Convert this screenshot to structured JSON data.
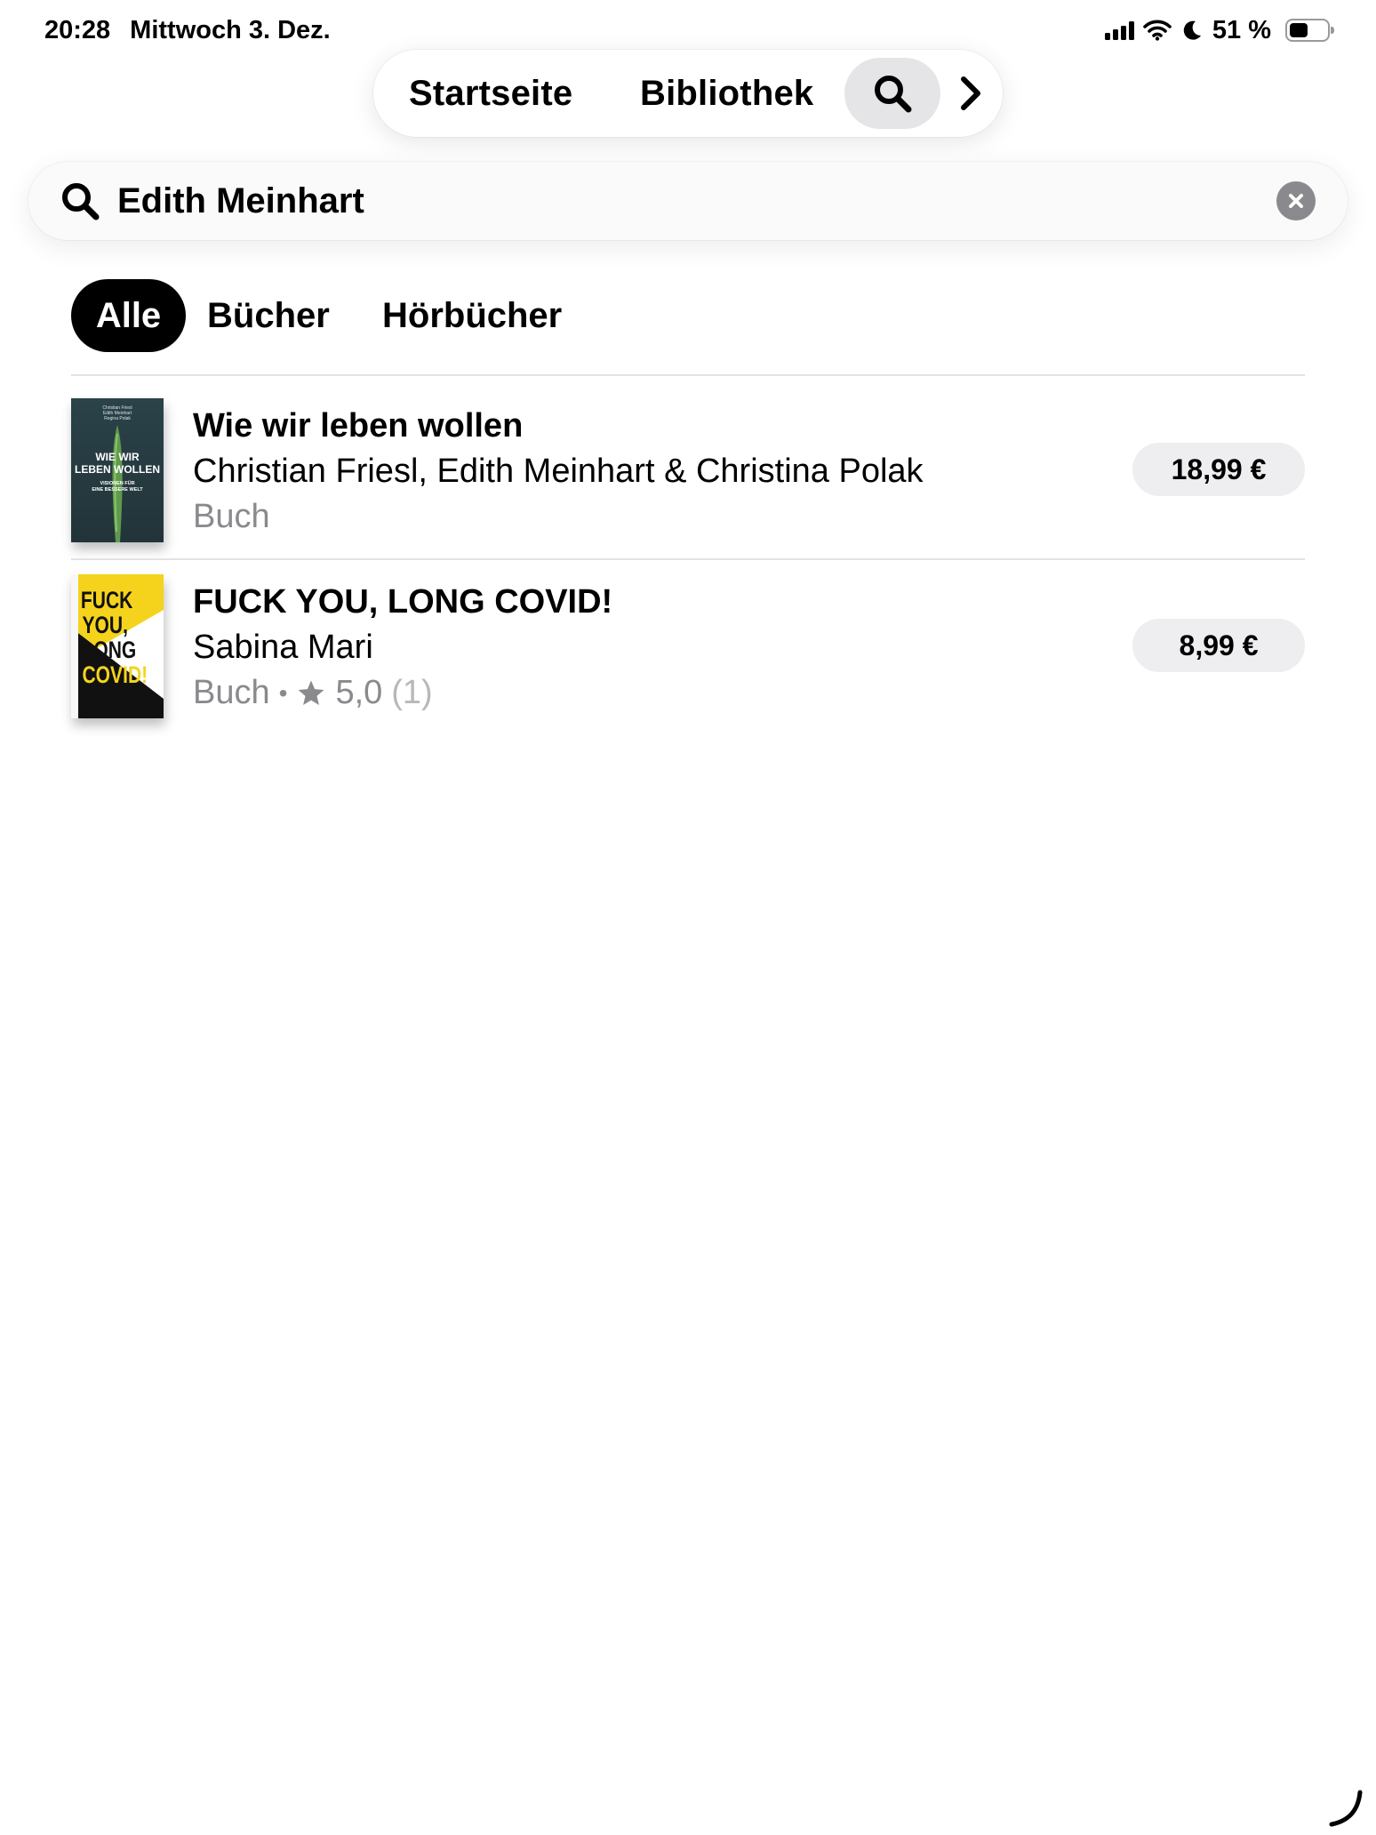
{
  "status_bar": {
    "time": "20:28",
    "date": "Mittwoch 3. Dez.",
    "battery": "51 %",
    "battery_level": 0.51,
    "icons": [
      "cellular-signal-icon",
      "wifi-icon",
      "moon-icon",
      "battery-icon"
    ]
  },
  "nav": {
    "home": "Startseite",
    "library": "Bibliothek",
    "search_icon": "search-icon",
    "more_icon": "chevron-right-icon"
  },
  "search": {
    "query": "Edith Meinhart",
    "icon": "search-icon",
    "clear_icon": "clear-icon"
  },
  "filters": {
    "all": "Alle",
    "books": "Bücher",
    "audiobooks": "Hörbücher",
    "selected": "Alle"
  },
  "results": [
    {
      "title": "Wie wir leben wollen",
      "authors": "Christian Friesl, Edith Meinhart & Christina Polak",
      "type": "Buch",
      "price": "18,99 €",
      "cover": {
        "authors_line1": "Christian Friesl",
        "authors_line2": "Edith Meinhart",
        "authors_line3": "Regina Polak",
        "title_line1": "WIE WIR",
        "title_line2": "LEBEN WOLLEN",
        "subtitle_line1": "VISIONEN FÜR",
        "subtitle_line2": "EINE BESSERE WELT",
        "colors": {
          "background": "#2f4a52",
          "accent": "#6fa25a"
        }
      }
    },
    {
      "title": "FUCK YOU, LONG COVID!",
      "authors": "Sabina Mari",
      "type": "Buch",
      "separator": "•",
      "rating": "5,0",
      "rating_count": "(1)",
      "price": "8,99 €",
      "cover": {
        "line1": "FUCK",
        "line2": "YOU,",
        "line3": "LONG",
        "line4": "COVID!",
        "colors": {
          "primary": "#f5d31d",
          "secondary": "#111111"
        }
      }
    }
  ],
  "colors": {
    "accent": "#000000",
    "muted_text": "#8a8a8e",
    "pill_background": "#eeeef0"
  }
}
